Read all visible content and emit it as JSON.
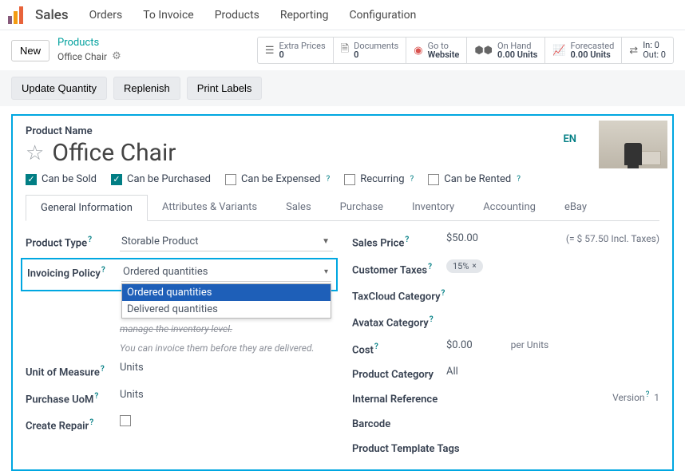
{
  "nav": {
    "app": "Sales",
    "items": [
      "Orders",
      "To Invoice",
      "Products",
      "Reporting",
      "Configuration"
    ]
  },
  "controls": {
    "new": "New",
    "breadcrumb_top": "Products",
    "breadcrumb_bottom": "Office Chair",
    "stats": {
      "extra_prices": {
        "label": "Extra Prices",
        "value": "0"
      },
      "documents": {
        "label": "Documents",
        "value": "0"
      },
      "goto": {
        "label": "Go to",
        "value": "Website"
      },
      "onhand": {
        "label": "On Hand",
        "value": "0.00 Units"
      },
      "forecasted": {
        "label": "Forecasted",
        "value": "0.00 Units"
      },
      "inout": {
        "in": "In: 0",
        "out": "Out: 0"
      }
    }
  },
  "actions": {
    "update": "Update Quantity",
    "replenish": "Replenish",
    "print": "Print Labels"
  },
  "form": {
    "product_name_label": "Product Name",
    "product_name": "Office Chair",
    "lang": "EN",
    "checks": {
      "sold": "Can be Sold",
      "purchased": "Can be Purchased",
      "expensed": "Can be Expensed",
      "recurring": "Recurring",
      "rented": "Can be Rented"
    },
    "tabs": [
      "General Information",
      "Attributes & Variants",
      "Sales",
      "Purchase",
      "Inventory",
      "Accounting",
      "eBay"
    ],
    "left": {
      "product_type_l": "Product Type",
      "product_type_v": "Storable Product",
      "invoicing_l": "Invoicing Policy",
      "invoicing_v": "Ordered quantities",
      "invoicing_opts": [
        "Ordered quantities",
        "Delivered quantities"
      ],
      "helper_strike": "manage the inventory level.",
      "helper": "You can invoice them before they are delivered.",
      "uom_l": "Unit of Measure",
      "uom_v": "Units",
      "puom_l": "Purchase UoM",
      "puom_v": "Units",
      "repair_l": "Create Repair"
    },
    "right": {
      "sales_price_l": "Sales Price",
      "sales_price_v": "$50.00",
      "sales_price_incl": "(= $ 57.50 Incl. Taxes)",
      "cust_tax_l": "Customer Taxes",
      "cust_tax_v": "15%",
      "taxcloud_l": "TaxCloud Category",
      "avatax_l": "Avatax Category",
      "cost_l": "Cost",
      "cost_v": "$0.00",
      "cost_unit": "per Units",
      "cat_l": "Product Category",
      "cat_v": "All",
      "intref_l": "Internal Reference",
      "version_l": "Version",
      "version_v": "1",
      "barcode_l": "Barcode",
      "tags_l": "Product Template Tags"
    }
  }
}
